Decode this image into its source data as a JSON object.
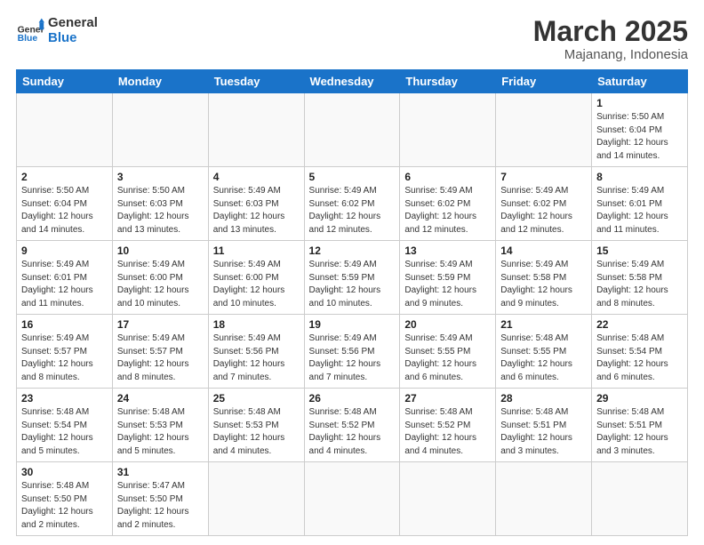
{
  "logo": {
    "general": "General",
    "blue": "Blue"
  },
  "header": {
    "month": "March 2025",
    "location": "Majanang, Indonesia"
  },
  "weekdays": [
    "Sunday",
    "Monday",
    "Tuesday",
    "Wednesday",
    "Thursday",
    "Friday",
    "Saturday"
  ],
  "days": {
    "1": {
      "sunrise": "5:50 AM",
      "sunset": "6:04 PM",
      "daylight": "12 hours and 14 minutes."
    },
    "2": {
      "sunrise": "5:50 AM",
      "sunset": "6:04 PM",
      "daylight": "12 hours and 14 minutes."
    },
    "3": {
      "sunrise": "5:50 AM",
      "sunset": "6:03 PM",
      "daylight": "12 hours and 13 minutes."
    },
    "4": {
      "sunrise": "5:49 AM",
      "sunset": "6:03 PM",
      "daylight": "12 hours and 13 minutes."
    },
    "5": {
      "sunrise": "5:49 AM",
      "sunset": "6:02 PM",
      "daylight": "12 hours and 12 minutes."
    },
    "6": {
      "sunrise": "5:49 AM",
      "sunset": "6:02 PM",
      "daylight": "12 hours and 12 minutes."
    },
    "7": {
      "sunrise": "5:49 AM",
      "sunset": "6:02 PM",
      "daylight": "12 hours and 12 minutes."
    },
    "8": {
      "sunrise": "5:49 AM",
      "sunset": "6:01 PM",
      "daylight": "12 hours and 11 minutes."
    },
    "9": {
      "sunrise": "5:49 AM",
      "sunset": "6:01 PM",
      "daylight": "12 hours and 11 minutes."
    },
    "10": {
      "sunrise": "5:49 AM",
      "sunset": "6:00 PM",
      "daylight": "12 hours and 10 minutes."
    },
    "11": {
      "sunrise": "5:49 AM",
      "sunset": "6:00 PM",
      "daylight": "12 hours and 10 minutes."
    },
    "12": {
      "sunrise": "5:49 AM",
      "sunset": "5:59 PM",
      "daylight": "12 hours and 10 minutes."
    },
    "13": {
      "sunrise": "5:49 AM",
      "sunset": "5:59 PM",
      "daylight": "12 hours and 9 minutes."
    },
    "14": {
      "sunrise": "5:49 AM",
      "sunset": "5:58 PM",
      "daylight": "12 hours and 9 minutes."
    },
    "15": {
      "sunrise": "5:49 AM",
      "sunset": "5:58 PM",
      "daylight": "12 hours and 8 minutes."
    },
    "16": {
      "sunrise": "5:49 AM",
      "sunset": "5:57 PM",
      "daylight": "12 hours and 8 minutes."
    },
    "17": {
      "sunrise": "5:49 AM",
      "sunset": "5:57 PM",
      "daylight": "12 hours and 8 minutes."
    },
    "18": {
      "sunrise": "5:49 AM",
      "sunset": "5:56 PM",
      "daylight": "12 hours and 7 minutes."
    },
    "19": {
      "sunrise": "5:49 AM",
      "sunset": "5:56 PM",
      "daylight": "12 hours and 7 minutes."
    },
    "20": {
      "sunrise": "5:49 AM",
      "sunset": "5:55 PM",
      "daylight": "12 hours and 6 minutes."
    },
    "21": {
      "sunrise": "5:48 AM",
      "sunset": "5:55 PM",
      "daylight": "12 hours and 6 minutes."
    },
    "22": {
      "sunrise": "5:48 AM",
      "sunset": "5:54 PM",
      "daylight": "12 hours and 6 minutes."
    },
    "23": {
      "sunrise": "5:48 AM",
      "sunset": "5:54 PM",
      "daylight": "12 hours and 5 minutes."
    },
    "24": {
      "sunrise": "5:48 AM",
      "sunset": "5:53 PM",
      "daylight": "12 hours and 5 minutes."
    },
    "25": {
      "sunrise": "5:48 AM",
      "sunset": "5:53 PM",
      "daylight": "12 hours and 4 minutes."
    },
    "26": {
      "sunrise": "5:48 AM",
      "sunset": "5:52 PM",
      "daylight": "12 hours and 4 minutes."
    },
    "27": {
      "sunrise": "5:48 AM",
      "sunset": "5:52 PM",
      "daylight": "12 hours and 4 minutes."
    },
    "28": {
      "sunrise": "5:48 AM",
      "sunset": "5:51 PM",
      "daylight": "12 hours and 3 minutes."
    },
    "29": {
      "sunrise": "5:48 AM",
      "sunset": "5:51 PM",
      "daylight": "12 hours and 3 minutes."
    },
    "30": {
      "sunrise": "5:48 AM",
      "sunset": "5:50 PM",
      "daylight": "12 hours and 2 minutes."
    },
    "31": {
      "sunrise": "5:47 AM",
      "sunset": "5:50 PM",
      "daylight": "12 hours and 2 minutes."
    }
  }
}
